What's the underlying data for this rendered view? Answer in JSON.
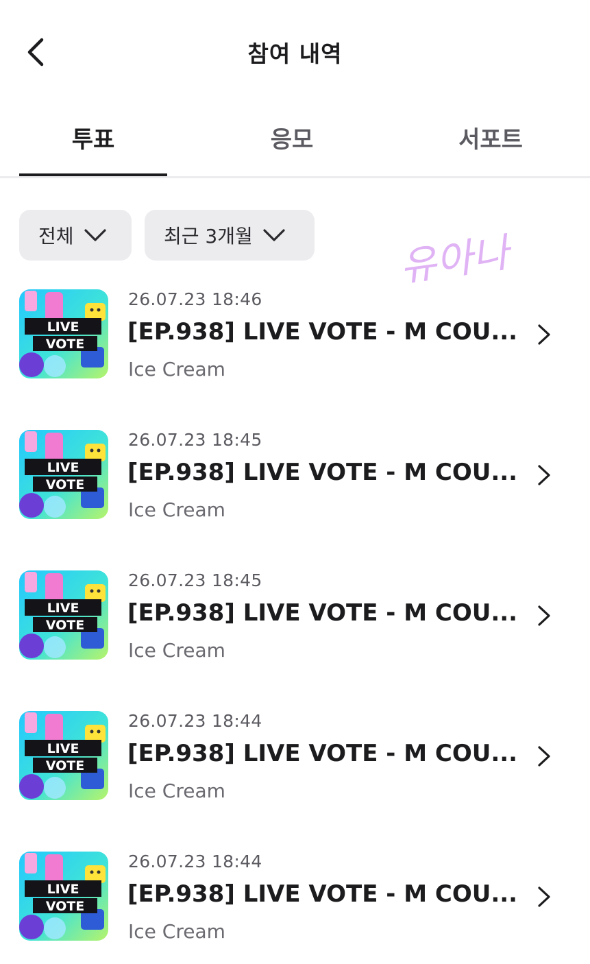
{
  "header": {
    "title": "참여 내역",
    "back_icon": "chevron-left-icon"
  },
  "tabs": [
    {
      "label": "투표",
      "active": true
    },
    {
      "label": "응모",
      "active": false
    },
    {
      "label": "서포트",
      "active": false
    }
  ],
  "filters": [
    {
      "label": "전체",
      "icon": "chevron-down-icon"
    },
    {
      "label": "최근 3개월",
      "icon": "chevron-down-icon"
    }
  ],
  "watermark": {
    "text": "유아나",
    "color": "#e0b3f5"
  },
  "thumbnail": {
    "line1": "LIVE",
    "line2": "VOTE"
  },
  "items": [
    {
      "date": "26.07.23 18:46",
      "title": "[EP.938] LIVE VOTE - M COU...",
      "artist": "Ice Cream"
    },
    {
      "date": "26.07.23 18:45",
      "title": "[EP.938] LIVE VOTE - M COU...",
      "artist": "Ice Cream"
    },
    {
      "date": "26.07.23 18:45",
      "title": "[EP.938] LIVE VOTE - M COU...",
      "artist": "Ice Cream"
    },
    {
      "date": "26.07.23 18:44",
      "title": "[EP.938] LIVE VOTE - M COU...",
      "artist": "Ice Cream"
    },
    {
      "date": "26.07.23 18:44",
      "title": "[EP.938] LIVE VOTE - M COU...",
      "artist": "Ice Cream"
    }
  ],
  "colors": {
    "text_primary": "#1c1c1e",
    "text_secondary": "#5a5a60",
    "chip_bg": "#ececef",
    "divider": "#ececee"
  }
}
